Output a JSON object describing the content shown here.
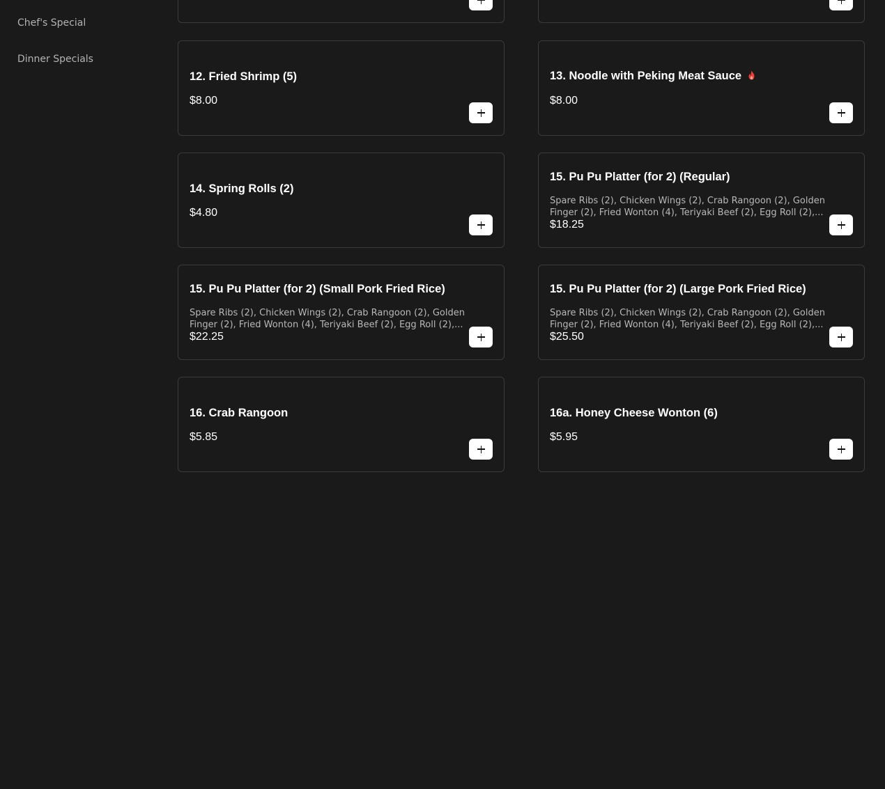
{
  "sidebar": {
    "items": [
      {
        "label": "Chef's Special"
      },
      {
        "label": "Dinner Specials"
      }
    ]
  },
  "menu": {
    "items": [
      {
        "title": "",
        "price": "",
        "description": ""
      },
      {
        "title": "",
        "price": "",
        "description": ""
      },
      {
        "title": "12. Fried Shrimp (5)",
        "price": "$8.00",
        "description": ""
      },
      {
        "title": "13. Noodle with Peking Meat Sauce",
        "price": "$8.00",
        "description": "",
        "icon": "flame-icon",
        "icon_color": "#e8423a"
      },
      {
        "title": "14. Spring Rolls (2)",
        "price": "$4.80",
        "description": ""
      },
      {
        "title": "15. Pu Pu Platter (for 2) (Regular)",
        "price": "$18.25",
        "description": "Spare Ribs (2), Chicken Wings (2), Crab Rangoon (2), Golden Finger (2), Fried Wonton (4), Teriyaki Beef (2), Egg Roll (2),..."
      },
      {
        "title": "15. Pu Pu Platter (for 2) (Small Pork Fried Rice)",
        "price": "$22.25",
        "description": "Spare Ribs (2), Chicken Wings (2), Crab Rangoon (2), Golden Finger (2), Fried Wonton (4), Teriyaki Beef (2), Egg Roll (2),..."
      },
      {
        "title": "15. Pu Pu Platter (for 2) (Large Pork Fried Rice)",
        "price": "$25.50",
        "description": "Spare Ribs (2), Chicken Wings (2), Crab Rangoon (2), Golden Finger (2), Fried Wonton (4), Teriyaki Beef (2), Egg Roll (2),..."
      },
      {
        "title": "16. Crab Rangoon",
        "price": "$5.85",
        "description": ""
      },
      {
        "title": "16a. Honey Cheese Wonton (6)",
        "price": "$5.95",
        "description": ""
      }
    ],
    "add_icon": "plus-icon"
  },
  "colors": {
    "background": "#1a1a1a",
    "card_border": "#3b3b3b",
    "button": "#ffffff",
    "flame": "#e8423a"
  }
}
